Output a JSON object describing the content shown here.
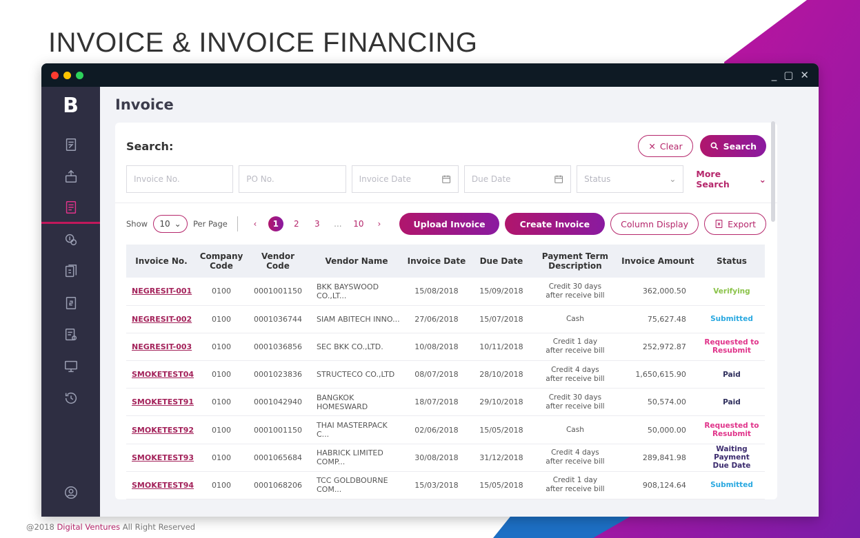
{
  "slide": {
    "title": "INVOICE & INVOICE FINANCING",
    "footer_prefix": "@2018 ",
    "footer_brand": "Digital Ventures",
    "footer_suffix": " All Right Reserved"
  },
  "window": {
    "controls": {
      "minimize": "_",
      "maximize": "▢",
      "close": "✕"
    }
  },
  "sidebar": {
    "logo": "B",
    "items": [
      {
        "icon": "document-edit-icon",
        "active": false
      },
      {
        "icon": "upload-box-icon",
        "active": false
      },
      {
        "icon": "invoice-icon",
        "active": true
      },
      {
        "icon": "coin-search-icon",
        "active": false
      },
      {
        "icon": "document-3-icon",
        "active": false
      },
      {
        "icon": "document-2-icon",
        "active": false
      },
      {
        "icon": "document-settings-icon",
        "active": false
      },
      {
        "icon": "monitor-icon",
        "active": false
      },
      {
        "icon": "history-icon",
        "active": false
      }
    ],
    "bottom_icon": "user-profile-icon"
  },
  "page": {
    "title": "Invoice"
  },
  "search": {
    "label": "Search:",
    "clear_label": "Clear",
    "search_label": "Search",
    "more_label": "More Search",
    "fields": {
      "invoice_no": "Invoice No.",
      "po_no": "PO No.",
      "invoice_date": "Invoice Date",
      "due_date": "Due Date",
      "status": "Status"
    }
  },
  "toolbar": {
    "show_label": "Show",
    "per_page_value": "10",
    "per_page_label": "Per Page",
    "pages": [
      "1",
      "2",
      "3",
      "...",
      "10"
    ],
    "current_page": "1",
    "prev": "‹",
    "next": "›",
    "upload_label": "Upload Invoice",
    "create_label": "Create Invoice",
    "column_label": "Column Display",
    "export_label": "Export"
  },
  "table": {
    "headers": {
      "invoice_no": "Invoice No.",
      "company_code_1": "Company",
      "company_code_2": "Code",
      "vendor_code": "Vendor Code",
      "vendor_name": "Vendor Name",
      "invoice_date": "Invoice Date",
      "due_date": "Due Date",
      "payment_term_1": "Payment Term",
      "payment_term_2": "Description",
      "invoice_amount": "Invoice Amount",
      "status": "Status"
    },
    "rows": [
      {
        "invoice_no": "NEGRESIT-001",
        "company_code": "0100",
        "vendor_code": "0001001150",
        "vendor_name": "BKK BAYSWOOD CO.,LT...",
        "invoice_date": "15/08/2018",
        "due_date": "15/09/2018",
        "term_1": "Credit 30 days",
        "term_2": "after receive bill",
        "amount": "362,000.50",
        "status_1": "Verifying",
        "status_2": "",
        "status_type": "verifying"
      },
      {
        "invoice_no": "NEGRESIT-002",
        "company_code": "0100",
        "vendor_code": "0001036744",
        "vendor_name": "SIAM ABITECH INNO...",
        "invoice_date": "27/06/2018",
        "due_date": "15/07/2018",
        "term_1": "Cash",
        "term_2": "",
        "amount": "75,627.48",
        "status_1": "Submitted",
        "status_2": "",
        "status_type": "submitted"
      },
      {
        "invoice_no": "NEGRESIT-003",
        "company_code": "0100",
        "vendor_code": "0001036856",
        "vendor_name": "SEC BKK CO.,LTD.",
        "invoice_date": "10/08/2018",
        "due_date": "10/11/2018",
        "term_1": "Credit 1 day",
        "term_2": "after receive bill",
        "amount": "252,972.87",
        "status_1": "Requested to",
        "status_2": "Resubmit",
        "status_type": "resubmit"
      },
      {
        "invoice_no": "SMOKETEST04",
        "company_code": "0100",
        "vendor_code": "0001023836",
        "vendor_name": "STRUCTECO CO.,LTD",
        "invoice_date": "08/07/2018",
        "due_date": "28/10/2018",
        "term_1": "Credit 4 days",
        "term_2": "after receive bill",
        "amount": "1,650,615.90",
        "status_1": "Paid",
        "status_2": "",
        "status_type": "paid"
      },
      {
        "invoice_no": "SMOKETEST91",
        "company_code": "0100",
        "vendor_code": "0001042940",
        "vendor_name": "BANGKOK HOMESWARD",
        "invoice_date": "18/07/2018",
        "due_date": "29/10/2018",
        "term_1": "Credit 30 days",
        "term_2": "after receive bill",
        "amount": "50,574.00",
        "status_1": "Paid",
        "status_2": "",
        "status_type": "paid"
      },
      {
        "invoice_no": "SMOKETEST92",
        "company_code": "0100",
        "vendor_code": "0001001150",
        "vendor_name": "THAI MASTERPACK C...",
        "invoice_date": "02/06/2018",
        "due_date": "15/05/2018",
        "term_1": "Cash",
        "term_2": "",
        "amount": "50,000.00",
        "status_1": "Requested to",
        "status_2": "Resubmit",
        "status_type": "resubmit"
      },
      {
        "invoice_no": "SMOKETEST93",
        "company_code": "0100",
        "vendor_code": "0001065684",
        "vendor_name": "HABRICK LIMITED COMP...",
        "invoice_date": "30/08/2018",
        "due_date": "31/12/2018",
        "term_1": "Credit 4 days",
        "term_2": "after receive bill",
        "amount": "289,841.98",
        "status_1": "Waiting Payment",
        "status_2": "Due Date",
        "status_type": "waiting"
      },
      {
        "invoice_no": "SMOKETEST94",
        "company_code": "0100",
        "vendor_code": "0001068206",
        "vendor_name": "TCC GOLDBOURNE COM...",
        "invoice_date": "15/03/2018",
        "due_date": "15/05/2018",
        "term_1": "Credit 1 day",
        "term_2": "after receive bill",
        "amount": "908,124.64",
        "status_1": "Submitted",
        "status_2": "",
        "status_type": "submitted"
      }
    ]
  },
  "colors": {
    "accent": "#b5266b",
    "sidebar": "#2e2e42",
    "titlebar": "#0e1a24"
  }
}
